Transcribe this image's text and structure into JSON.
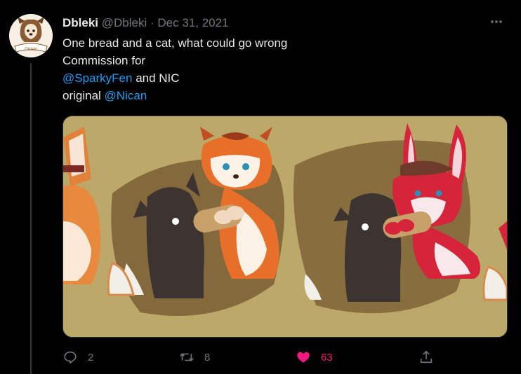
{
  "tweet": {
    "display_name": "Dbleki",
    "handle": "@Dbleki",
    "separator": "·",
    "date": "Dec 31, 2021",
    "text_line1": "One bread and a cat, what could go wrong",
    "text_line2": "Commission for",
    "mention1": "@SparkyFen",
    "text_line3_rest": " and NIC",
    "text_line4_prefix": "original ",
    "mention2": "@Nican"
  },
  "avatar": {
    "caption": "Dbleki"
  },
  "actions": {
    "reply_count": "2",
    "retweet_count": "8",
    "like_count": "63"
  },
  "colors": {
    "background": "#000000",
    "text": "#e7e9ea",
    "muted": "#71767b",
    "link": "#1d9bf0",
    "like": "#f91880",
    "media_bg": "#bca96a"
  },
  "icons": [
    "more-icon",
    "reply-icon",
    "retweet-icon",
    "heart-icon",
    "share-icon"
  ]
}
